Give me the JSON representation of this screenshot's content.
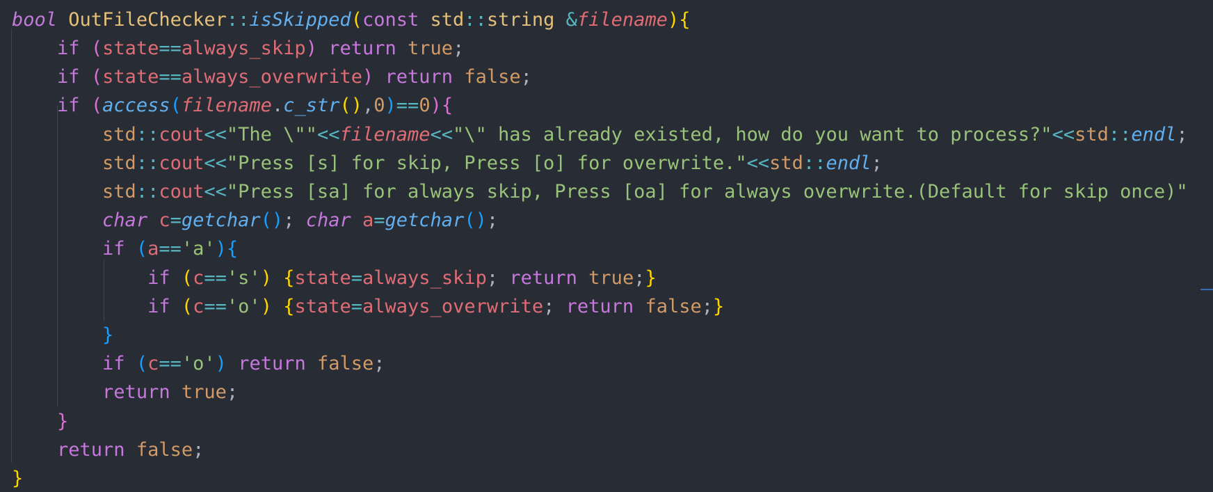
{
  "editor": {
    "lines": [
      {
        "tokens": [
          {
            "t": "bool",
            "c": "kwi"
          },
          {
            "t": " ",
            "c": "pl"
          },
          {
            "t": "OutFileChecker",
            "c": "typ"
          },
          {
            "t": "::",
            "c": "op"
          },
          {
            "t": "isSkipped",
            "c": "fn"
          },
          {
            "t": "(",
            "c": "b1"
          },
          {
            "t": "const",
            "c": "kw"
          },
          {
            "t": " ",
            "c": "pl"
          },
          {
            "t": "std",
            "c": "typ"
          },
          {
            "t": "::",
            "c": "op"
          },
          {
            "t": "string",
            "c": "typ"
          },
          {
            "t": " ",
            "c": "pl"
          },
          {
            "t": "&",
            "c": "op"
          },
          {
            "t": "filename",
            "c": "par"
          },
          {
            "t": ")",
            "c": "b1"
          },
          {
            "t": "{",
            "c": "b1"
          }
        ]
      },
      {
        "tokens": [
          {
            "t": "    ",
            "c": "pl"
          },
          {
            "t": "if",
            "c": "kw"
          },
          {
            "t": " ",
            "c": "pl"
          },
          {
            "t": "(",
            "c": "b2"
          },
          {
            "t": "state",
            "c": "var"
          },
          {
            "t": "==",
            "c": "op"
          },
          {
            "t": "always_skip",
            "c": "var"
          },
          {
            "t": ")",
            "c": "b2"
          },
          {
            "t": " ",
            "c": "pl"
          },
          {
            "t": "return",
            "c": "kw"
          },
          {
            "t": " ",
            "c": "pl"
          },
          {
            "t": "true",
            "c": "bool"
          },
          {
            "t": ";",
            "c": "pl"
          }
        ]
      },
      {
        "tokens": [
          {
            "t": "    ",
            "c": "pl"
          },
          {
            "t": "if",
            "c": "kw"
          },
          {
            "t": " ",
            "c": "pl"
          },
          {
            "t": "(",
            "c": "b2"
          },
          {
            "t": "state",
            "c": "var"
          },
          {
            "t": "==",
            "c": "op"
          },
          {
            "t": "always_overwrite",
            "c": "var"
          },
          {
            "t": ")",
            "c": "b2"
          },
          {
            "t": " ",
            "c": "pl"
          },
          {
            "t": "return",
            "c": "kw"
          },
          {
            "t": " ",
            "c": "pl"
          },
          {
            "t": "false",
            "c": "bool"
          },
          {
            "t": ";",
            "c": "pl"
          }
        ]
      },
      {
        "tokens": [
          {
            "t": "    ",
            "c": "pl"
          },
          {
            "t": "if",
            "c": "kw"
          },
          {
            "t": " ",
            "c": "pl"
          },
          {
            "t": "(",
            "c": "b2"
          },
          {
            "t": "access",
            "c": "fn"
          },
          {
            "t": "(",
            "c": "b3"
          },
          {
            "t": "filename",
            "c": "par"
          },
          {
            "t": ".",
            "c": "pl"
          },
          {
            "t": "c_str",
            "c": "fn"
          },
          {
            "t": "()",
            "c": "b1"
          },
          {
            "t": ",",
            "c": "pl"
          },
          {
            "t": "0",
            "c": "num"
          },
          {
            "t": ")",
            "c": "b3"
          },
          {
            "t": "==",
            "c": "op"
          },
          {
            "t": "0",
            "c": "num"
          },
          {
            "t": ")",
            "c": "b2"
          },
          {
            "t": "{",
            "c": "b2"
          }
        ]
      },
      {
        "tokens": [
          {
            "t": "        ",
            "c": "pl"
          },
          {
            "t": "std",
            "c": "ty2"
          },
          {
            "t": "::",
            "c": "op"
          },
          {
            "t": "cout",
            "c": "var"
          },
          {
            "t": "<<",
            "c": "op"
          },
          {
            "t": "\"The \\\"\"",
            "c": "str"
          },
          {
            "t": "<<",
            "c": "op"
          },
          {
            "t": "filename",
            "c": "par"
          },
          {
            "t": "<<",
            "c": "op"
          },
          {
            "t": "\"\\\" has already existed, how do you want to process?\"",
            "c": "str"
          },
          {
            "t": "<<",
            "c": "op"
          },
          {
            "t": "std",
            "c": "ty2"
          },
          {
            "t": "::",
            "c": "op"
          },
          {
            "t": "endl",
            "c": "fn"
          },
          {
            "t": ";",
            "c": "pl"
          }
        ]
      },
      {
        "tokens": [
          {
            "t": "        ",
            "c": "pl"
          },
          {
            "t": "std",
            "c": "ty2"
          },
          {
            "t": "::",
            "c": "op"
          },
          {
            "t": "cout",
            "c": "var"
          },
          {
            "t": "<<",
            "c": "op"
          },
          {
            "t": "\"Press [s] for skip, Press [o] for overwrite.\"",
            "c": "str"
          },
          {
            "t": "<<",
            "c": "op"
          },
          {
            "t": "std",
            "c": "ty2"
          },
          {
            "t": "::",
            "c": "op"
          },
          {
            "t": "endl",
            "c": "fn"
          },
          {
            "t": ";",
            "c": "pl"
          }
        ]
      },
      {
        "tokens": [
          {
            "t": "        ",
            "c": "pl"
          },
          {
            "t": "std",
            "c": "ty2"
          },
          {
            "t": "::",
            "c": "op"
          },
          {
            "t": "cout",
            "c": "var"
          },
          {
            "t": "<<",
            "c": "op"
          },
          {
            "t": "\"Press [sa] for always skip, Press [oa] for always overwrite.(Default for skip once)\"",
            "c": "str"
          }
        ]
      },
      {
        "tokens": [
          {
            "t": "        ",
            "c": "pl"
          },
          {
            "t": "char",
            "c": "kwi"
          },
          {
            "t": " ",
            "c": "pl"
          },
          {
            "t": "c",
            "c": "var"
          },
          {
            "t": "=",
            "c": "op"
          },
          {
            "t": "getchar",
            "c": "fn"
          },
          {
            "t": "()",
            "c": "b3"
          },
          {
            "t": "; ",
            "c": "pl"
          },
          {
            "t": "char",
            "c": "kwi"
          },
          {
            "t": " ",
            "c": "pl"
          },
          {
            "t": "a",
            "c": "var"
          },
          {
            "t": "=",
            "c": "op"
          },
          {
            "t": "getchar",
            "c": "fn"
          },
          {
            "t": "()",
            "c": "b3"
          },
          {
            "t": ";",
            "c": "pl"
          }
        ]
      },
      {
        "tokens": [
          {
            "t": "        ",
            "c": "pl"
          },
          {
            "t": "if",
            "c": "kw"
          },
          {
            "t": " ",
            "c": "pl"
          },
          {
            "t": "(",
            "c": "b3"
          },
          {
            "t": "a",
            "c": "var"
          },
          {
            "t": "==",
            "c": "op"
          },
          {
            "t": "'a'",
            "c": "str"
          },
          {
            "t": ")",
            "c": "b3"
          },
          {
            "t": "{",
            "c": "b3"
          }
        ]
      },
      {
        "tokens": [
          {
            "t": "            ",
            "c": "pl"
          },
          {
            "t": "if",
            "c": "kw"
          },
          {
            "t": " ",
            "c": "pl"
          },
          {
            "t": "(",
            "c": "b1"
          },
          {
            "t": "c",
            "c": "var"
          },
          {
            "t": "==",
            "c": "op"
          },
          {
            "t": "'s'",
            "c": "str"
          },
          {
            "t": ")",
            "c": "b1"
          },
          {
            "t": " ",
            "c": "pl"
          },
          {
            "t": "{",
            "c": "b1"
          },
          {
            "t": "state",
            "c": "var"
          },
          {
            "t": "=",
            "c": "op"
          },
          {
            "t": "always_skip",
            "c": "var"
          },
          {
            "t": "; ",
            "c": "pl"
          },
          {
            "t": "return",
            "c": "kw"
          },
          {
            "t": " ",
            "c": "pl"
          },
          {
            "t": "true",
            "c": "bool"
          },
          {
            "t": ";",
            "c": "pl"
          },
          {
            "t": "}",
            "c": "b1"
          }
        ]
      },
      {
        "tokens": [
          {
            "t": "            ",
            "c": "pl"
          },
          {
            "t": "if",
            "c": "kw"
          },
          {
            "t": " ",
            "c": "pl"
          },
          {
            "t": "(",
            "c": "b1"
          },
          {
            "t": "c",
            "c": "var"
          },
          {
            "t": "==",
            "c": "op"
          },
          {
            "t": "'o'",
            "c": "str"
          },
          {
            "t": ")",
            "c": "b1"
          },
          {
            "t": " ",
            "c": "pl"
          },
          {
            "t": "{",
            "c": "b1"
          },
          {
            "t": "state",
            "c": "var"
          },
          {
            "t": "=",
            "c": "op"
          },
          {
            "t": "always_overwrite",
            "c": "var"
          },
          {
            "t": "; ",
            "c": "pl"
          },
          {
            "t": "return",
            "c": "kw"
          },
          {
            "t": " ",
            "c": "pl"
          },
          {
            "t": "false",
            "c": "bool"
          },
          {
            "t": ";",
            "c": "pl"
          },
          {
            "t": "}",
            "c": "b1"
          }
        ]
      },
      {
        "tokens": [
          {
            "t": "        ",
            "c": "pl"
          },
          {
            "t": "}",
            "c": "b3"
          }
        ]
      },
      {
        "tokens": [
          {
            "t": "        ",
            "c": "pl"
          },
          {
            "t": "if",
            "c": "kw"
          },
          {
            "t": " ",
            "c": "pl"
          },
          {
            "t": "(",
            "c": "b3"
          },
          {
            "t": "c",
            "c": "var"
          },
          {
            "t": "==",
            "c": "op"
          },
          {
            "t": "'o'",
            "c": "str"
          },
          {
            "t": ")",
            "c": "b3"
          },
          {
            "t": " ",
            "c": "pl"
          },
          {
            "t": "return",
            "c": "kw"
          },
          {
            "t": " ",
            "c": "pl"
          },
          {
            "t": "false",
            "c": "bool"
          },
          {
            "t": ";",
            "c": "pl"
          }
        ]
      },
      {
        "tokens": [
          {
            "t": "        ",
            "c": "pl"
          },
          {
            "t": "return",
            "c": "kw"
          },
          {
            "t": " ",
            "c": "pl"
          },
          {
            "t": "true",
            "c": "bool"
          },
          {
            "t": ";",
            "c": "pl"
          }
        ]
      },
      {
        "tokens": [
          {
            "t": "    ",
            "c": "pl"
          },
          {
            "t": "}",
            "c": "b2"
          }
        ]
      },
      {
        "tokens": [
          {
            "t": "    ",
            "c": "pl"
          },
          {
            "t": "return",
            "c": "kw"
          },
          {
            "t": " ",
            "c": "pl"
          },
          {
            "t": "false",
            "c": "bool"
          },
          {
            "t": ";",
            "c": "pl"
          }
        ]
      },
      {
        "tokens": [
          {
            "t": "}",
            "c": "b1"
          }
        ]
      }
    ]
  },
  "theme": {
    "background": "#282c34",
    "keyword": "#c678dd",
    "type": "#e5c07b",
    "function": "#61afef",
    "variable": "#e06c75",
    "string": "#98c379",
    "number": "#d19a66",
    "operator": "#56b6c2",
    "bracket_level_1": "#ffd700",
    "bracket_level_2": "#da70d6",
    "bracket_level_3": "#179fff"
  }
}
